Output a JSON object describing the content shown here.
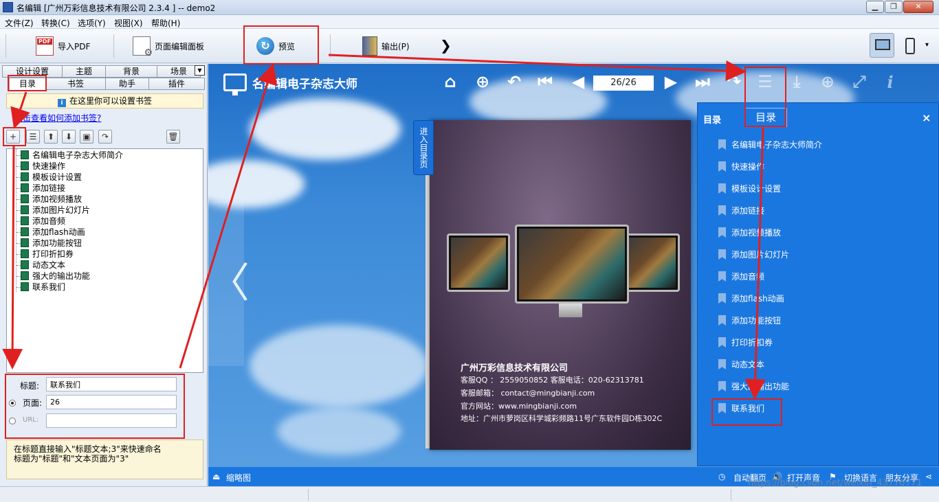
{
  "window": {
    "title": "名编辑 [广州万彩信息技术有限公司 2.3.4 ] -- demo2",
    "min_symbol": "▁",
    "max_symbol": "❐",
    "close_symbol": "✕"
  },
  "menu": [
    "文件(Z)",
    "转换(C)",
    "选项(Y)",
    "视图(X)",
    "帮助(H)"
  ],
  "toolbar": {
    "import_pdf": "导入PDF",
    "page_editor": "页面编辑面板",
    "preview": "预览",
    "output": "输出(P)",
    "more": "❯",
    "device_dropdown": "▾"
  },
  "left": {
    "tabs_row1": [
      "设计设置",
      "主题",
      "背景",
      "场景"
    ],
    "tabs_row2": [
      "目录",
      "书签",
      "助手",
      "插件"
    ],
    "tab_dropdown": "▼",
    "info_text": "在这里你可以设置书签",
    "info_icon": "i",
    "help_link": "点击查看如何添加书签?",
    "buttons": {
      "add": "+",
      "indent": "☰",
      "up": "⬆",
      "down": "⬇",
      "save": "▣",
      "redo": "↷",
      "delete": "🗑"
    },
    "tree_items": [
      "名编辑电子杂志大师简介",
      "快速操作",
      "模板设计设置",
      "添加链接",
      "添加视频播放",
      "添加图片幻灯片",
      "添加音频",
      "添加flash动画",
      "添加功能按钮",
      "打印折扣券",
      "动态文本",
      "强大的输出功能",
      "联系我们"
    ],
    "edit": {
      "title_label": "标题:",
      "title_value": "联系我们",
      "page_label": "页面:",
      "page_value": "26",
      "url_label": "URL:",
      "url_value": ""
    },
    "tip": "在标题直接输入\"标题文本;3\"来快速命名\n标题为\"标题\"和\"文本页面为\"3\""
  },
  "viewer": {
    "brand": "名编辑电子杂志大师",
    "page_indicator": "26/26",
    "toc_tab": "进入目录页",
    "tooltip": "目录",
    "nav_icons": {
      "home": "⌂",
      "zoom": "⊕",
      "back": "↶",
      "first": "⏮",
      "prev": "◀",
      "next": "▶",
      "last": "⏭",
      "forward": "↷",
      "toc": "☰",
      "download": "⤓",
      "share": "⊕",
      "fullscreen": "⤢",
      "info": "i"
    },
    "prev_arrow": "〈",
    "book": {
      "company": "广州万彩信息技术有限公司",
      "line1": "客服QQ ：  2559050852      客服电话：020-62313781",
      "line2": "客服邮箱：   contact@mingbianji.com",
      "line3": "官方网站：www.mingbianji.com",
      "line4": "地址：广州市萝岗区科学城彩频路11号广东软件园D栋302C"
    },
    "toc_panel": {
      "title": "目录",
      "close": "×",
      "items": [
        "名编辑电子杂志大师简介",
        "快速操作",
        "模板设计设置",
        "添加链接",
        "添加视频播放",
        "添加图片幻灯片",
        "添加音频",
        "添加flash动画",
        "添加功能按钮",
        "打印折扣券",
        "动态文本",
        "强大的输出功能",
        "联系我们"
      ]
    },
    "bottom": {
      "thumbnail": "缩略图",
      "thumbnail_icon": "⏏",
      "autoflip": "自动翻页",
      "autoflip_icon": "◷",
      "sound": "打开声音",
      "sound_icon": "🔊",
      "language": "切换语言",
      "language_icon": "⚑",
      "share": "朋友分享",
      "share_icon": "⋖"
    }
  },
  "watermark": "https://blog.csdn.net/weixin_43770771",
  "colors": {
    "annotation": "#e02020",
    "toc_panel": "#1b77e0",
    "viewer_sky": "#3c8ad8"
  }
}
